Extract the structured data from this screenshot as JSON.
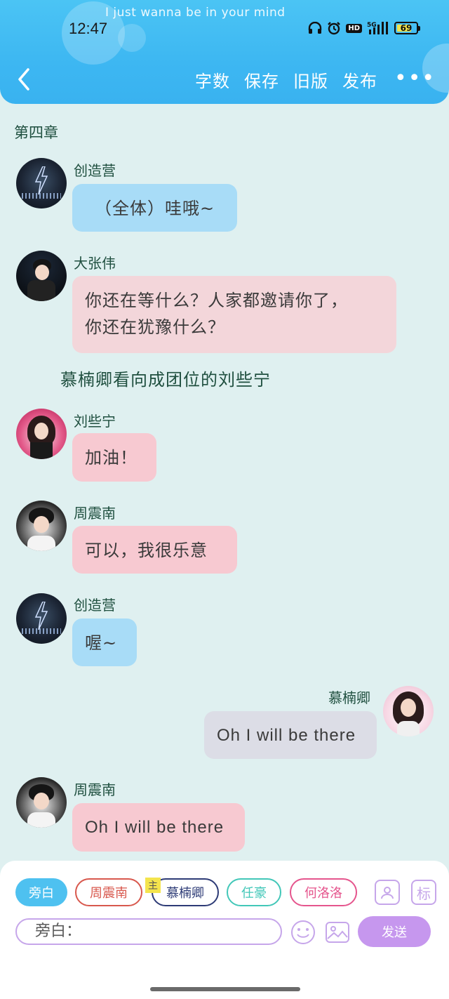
{
  "status_bar": {
    "lyric": "I just wanna be in your mind",
    "time": "12:47",
    "network": "5G",
    "hd": "HD",
    "battery": "69"
  },
  "toolbar": {
    "word_count": "字数",
    "save": "保存",
    "old_version": "旧版",
    "publish": "发布",
    "more": "•••"
  },
  "chapter_title": "第四章",
  "messages": [
    {
      "name": "创造营",
      "text": "（全体）哇哦~"
    },
    {
      "name": "大张伟",
      "text_line1": "你还在等什么？人家都邀请你了，",
      "text_line2": "你还在犹豫什么？"
    },
    {
      "narration": "慕楠卿看向成团位的刘些宁"
    },
    {
      "name": "刘些宁",
      "text": "加油！"
    },
    {
      "name": "周震南",
      "text": "可以，我很乐意"
    },
    {
      "name": "创造营",
      "text": "喔~"
    },
    {
      "name": "慕楠卿",
      "text": "Oh I will be there"
    },
    {
      "name": "周震南",
      "text": "Oh I will be there"
    }
  ],
  "roles": {
    "narration": "旁白",
    "zzn": "周震南",
    "main_badge": "主",
    "mnq": "慕楠卿",
    "rh": "任豪",
    "hll": "何洛洛"
  },
  "tools": {
    "mark": "标"
  },
  "input": {
    "prefix": "旁白："
  },
  "send": "发送",
  "colors": {
    "header": "#3db7f2",
    "background": "#dff0f0",
    "blue_bubble": "#a8dcf7",
    "pink_bubble": "#f7c9d1",
    "gray_bubble": "#dcdde6",
    "send": "#c697ee"
  }
}
